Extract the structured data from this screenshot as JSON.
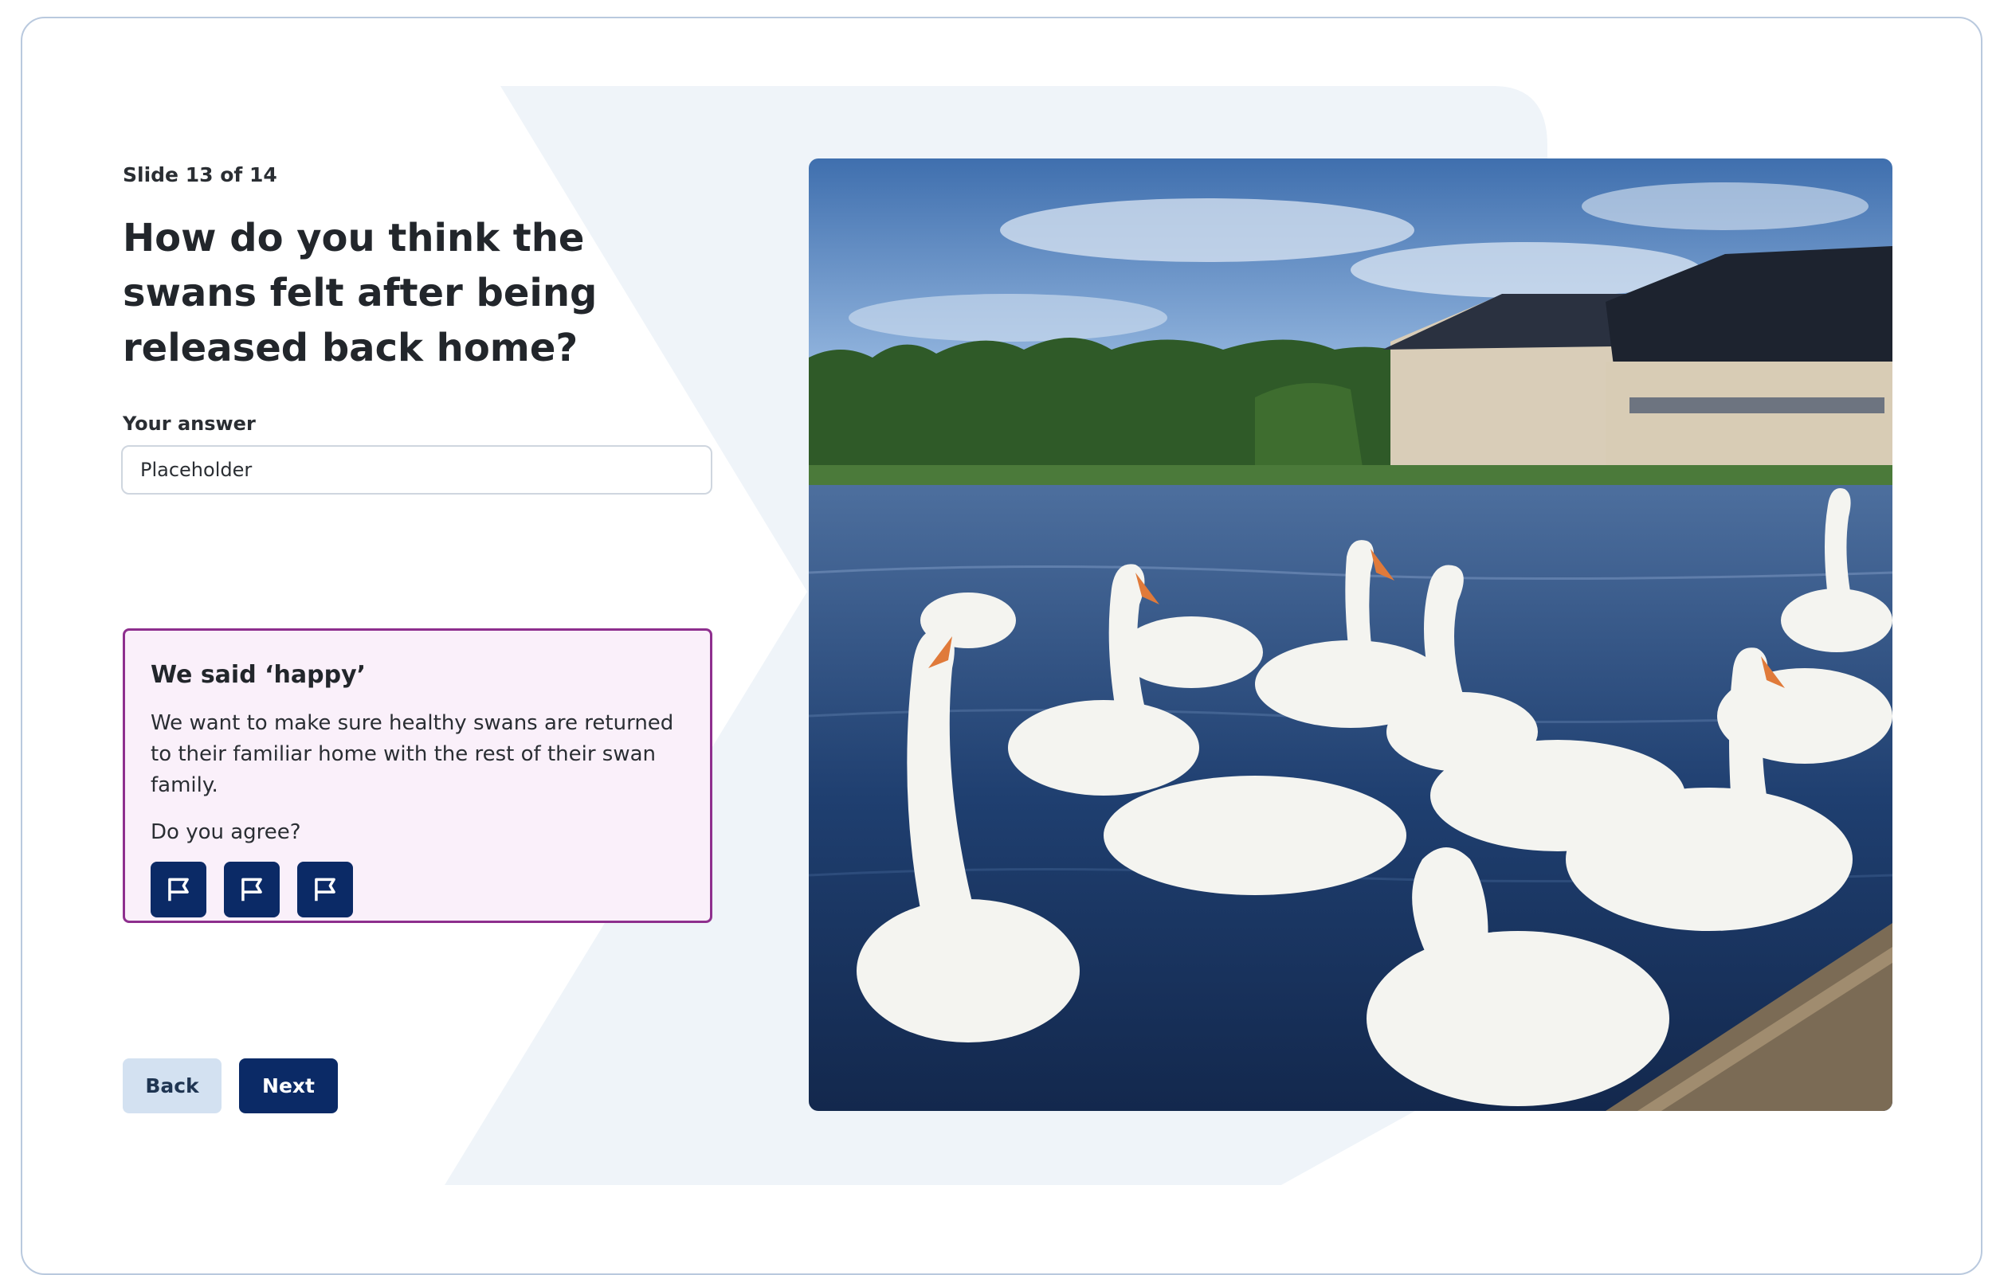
{
  "slide": {
    "counter": "Slide 13 of 14"
  },
  "question": {
    "text": "How do you think the swans felt after being released back home?"
  },
  "answer": {
    "label": "Your answer",
    "placeholder": "Placeholder"
  },
  "callout": {
    "title": "We said ‘happy’",
    "body": "We want to make sure healthy swans are returned to their familiar home with the rest of their swan family.",
    "prompt": "Do you agree?",
    "flag_icons": [
      "flag-icon",
      "flag-icon",
      "flag-icon"
    ]
  },
  "navigation": {
    "back_label": "Back",
    "next_label": "Next"
  },
  "colors": {
    "primary": "#0b2a66",
    "secondary_button": "#d3e1f1",
    "callout_border": "#8e2f8e",
    "callout_background": "#faf0fa",
    "background_shape": "#eff4f9"
  }
}
